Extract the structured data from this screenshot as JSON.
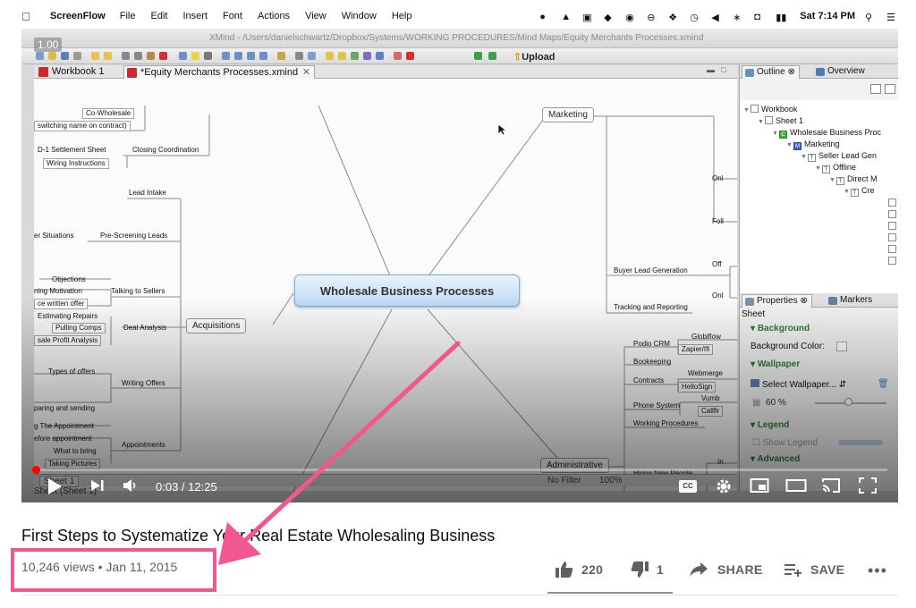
{
  "mac_menu": {
    "app_name": "ScreenFlow",
    "items": [
      "File",
      "Edit",
      "Insert",
      "Font",
      "Actions",
      "View",
      "Window",
      "Help"
    ],
    "clock": "Sat 7:14 PM"
  },
  "xmind": {
    "window_path": "XMind - /Users/danielschwartz/Dropbox/Systems/WORKING PROCEDURES/Mind Maps/Equity Merchants Processes.xmind",
    "upload_label": "Upload",
    "tabs": [
      "Workbook 1",
      "*Equity Merchants Processes.xmind"
    ],
    "central_topic": "Wholesale Business Processes",
    "main_topics": {
      "marketing": "Marketing",
      "acquisitions": "Acquisitions",
      "administrative": "Administrative"
    },
    "left_nodes": {
      "co_wholesale": "Co-Wholesale",
      "switching": "switching name on contract)",
      "d1_settlement": "D-1 Settlement Sheet",
      "closing_coordination": "Closing Coordination",
      "wiring_instructions": "Wiring Instructions",
      "lead_intake": "Lead Intake",
      "er_situations": "er Situations",
      "pre_screening": "Pre-Screening Leads",
      "objections": "Objections",
      "ning_motivation": "ning Motivation",
      "talking_to_sellers": "Talking to Sellers",
      "written_offer": "ce written offer",
      "estimating_repairs": "Estimating Repairs",
      "pulling_comps": "Pulling Comps",
      "deal_analysis": "Deal Analysis",
      "profit_analysis": "sale Profit Analysis",
      "types_of_offers": "Types of offers",
      "writing_offers": "Writing Offers",
      "paring_sending": "paring and sending",
      "the_appointment": "g The Appointment",
      "before_appointment": "efore appointment",
      "appointments": "Appointments",
      "what_to_bring": "What to bring",
      "taking_pictures": "Taking Pictures"
    },
    "right_nodes": {
      "onl1": "Onl",
      "foll": "Foll",
      "buyer_lead_generation": "Buyer Lead Generation",
      "off": "Off",
      "onl2": "Onl",
      "tracking_reporting": "Tracking and Reporting",
      "globiflow": "Globiflow",
      "podio_crm": "Podio CRM",
      "zapier": "Zapier/Ifi",
      "bookeeping": "Bookeeping",
      "webmerge": "Webmerge",
      "contracts": "Contracts",
      "hellosign": "HelloSign",
      "vumb": "Vumb",
      "phone_system": "Phone System",
      "callfir": "Callfir",
      "working_procedures": "Working Procedures",
      "in": "In",
      "hiring_new_people": "Hiring New People"
    },
    "outline": {
      "tab_outline": "Outline",
      "tab_overview": "Overview",
      "tree": [
        "Workbook",
        "Sheet 1",
        "Wholesale Business Proc",
        "Marketing",
        "Seller Lead Gen",
        "Offline",
        "Direct M",
        "Cre"
      ]
    },
    "properties": {
      "tab_properties": "Properties",
      "tab_markers": "Markers",
      "sheet": "Sheet",
      "background": "Background",
      "background_color": "Background Color:",
      "wallpaper": "Wallpaper",
      "select_wallpaper": "Select Wallpaper...",
      "opacity_value": "60",
      "opacity_unit": "%",
      "legend": "Legend",
      "show_legend": "Show Legend",
      "advanced": "Advanced"
    },
    "status": {
      "sheet_tab": "Sheet 1",
      "sheet_label": "Sheet (Sheet 1)",
      "filter": "No Filter",
      "zoom": "100%"
    }
  },
  "player": {
    "speed_badge": "1.00",
    "current_time": "0:03",
    "separator": " / ",
    "duration": "12:25",
    "progress_fraction": 0.004,
    "accent_color": "#ff0000"
  },
  "video_info": {
    "title": "First Steps to Systematize Your Real Estate Wholesaling Business",
    "views": "10,246 views",
    "dot": " • ",
    "date": "Jan 11, 2015",
    "likes": "220",
    "dislikes": "1",
    "share_label": "SHARE",
    "save_label": "SAVE",
    "highlight_color": "#f2578f"
  }
}
